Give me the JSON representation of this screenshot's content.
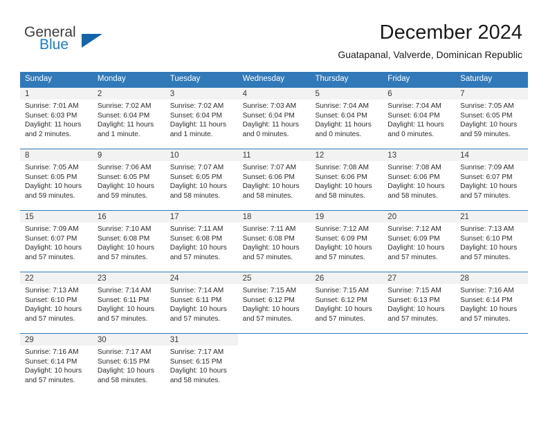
{
  "brand": {
    "name_part1": "General",
    "name_part2": "Blue",
    "triangle_color": "#1464aa",
    "blue_color": "#1d7cc4"
  },
  "header": {
    "title": "December 2024",
    "subtitle": "Guatapanal, Valverde, Dominican Republic"
  },
  "theme": {
    "header_blue": "#3179b8",
    "day_band_gray": "#f2f2f2"
  },
  "weekdays": [
    "Sunday",
    "Monday",
    "Tuesday",
    "Wednesday",
    "Thursday",
    "Friday",
    "Saturday"
  ],
  "weeks": [
    [
      {
        "day": "1",
        "sunrise": "Sunrise: 7:01 AM",
        "sunset": "Sunset: 6:03 PM",
        "daylight1": "Daylight: 11 hours",
        "daylight2": "and 2 minutes."
      },
      {
        "day": "2",
        "sunrise": "Sunrise: 7:02 AM",
        "sunset": "Sunset: 6:04 PM",
        "daylight1": "Daylight: 11 hours",
        "daylight2": "and 1 minute."
      },
      {
        "day": "3",
        "sunrise": "Sunrise: 7:02 AM",
        "sunset": "Sunset: 6:04 PM",
        "daylight1": "Daylight: 11 hours",
        "daylight2": "and 1 minute."
      },
      {
        "day": "4",
        "sunrise": "Sunrise: 7:03 AM",
        "sunset": "Sunset: 6:04 PM",
        "daylight1": "Daylight: 11 hours",
        "daylight2": "and 0 minutes."
      },
      {
        "day": "5",
        "sunrise": "Sunrise: 7:04 AM",
        "sunset": "Sunset: 6:04 PM",
        "daylight1": "Daylight: 11 hours",
        "daylight2": "and 0 minutes."
      },
      {
        "day": "6",
        "sunrise": "Sunrise: 7:04 AM",
        "sunset": "Sunset: 6:04 PM",
        "daylight1": "Daylight: 11 hours",
        "daylight2": "and 0 minutes."
      },
      {
        "day": "7",
        "sunrise": "Sunrise: 7:05 AM",
        "sunset": "Sunset: 6:05 PM",
        "daylight1": "Daylight: 10 hours",
        "daylight2": "and 59 minutes."
      }
    ],
    [
      {
        "day": "8",
        "sunrise": "Sunrise: 7:05 AM",
        "sunset": "Sunset: 6:05 PM",
        "daylight1": "Daylight: 10 hours",
        "daylight2": "and 59 minutes."
      },
      {
        "day": "9",
        "sunrise": "Sunrise: 7:06 AM",
        "sunset": "Sunset: 6:05 PM",
        "daylight1": "Daylight: 10 hours",
        "daylight2": "and 59 minutes."
      },
      {
        "day": "10",
        "sunrise": "Sunrise: 7:07 AM",
        "sunset": "Sunset: 6:05 PM",
        "daylight1": "Daylight: 10 hours",
        "daylight2": "and 58 minutes."
      },
      {
        "day": "11",
        "sunrise": "Sunrise: 7:07 AM",
        "sunset": "Sunset: 6:06 PM",
        "daylight1": "Daylight: 10 hours",
        "daylight2": "and 58 minutes."
      },
      {
        "day": "12",
        "sunrise": "Sunrise: 7:08 AM",
        "sunset": "Sunset: 6:06 PM",
        "daylight1": "Daylight: 10 hours",
        "daylight2": "and 58 minutes."
      },
      {
        "day": "13",
        "sunrise": "Sunrise: 7:08 AM",
        "sunset": "Sunset: 6:06 PM",
        "daylight1": "Daylight: 10 hours",
        "daylight2": "and 58 minutes."
      },
      {
        "day": "14",
        "sunrise": "Sunrise: 7:09 AM",
        "sunset": "Sunset: 6:07 PM",
        "daylight1": "Daylight: 10 hours",
        "daylight2": "and 57 minutes."
      }
    ],
    [
      {
        "day": "15",
        "sunrise": "Sunrise: 7:09 AM",
        "sunset": "Sunset: 6:07 PM",
        "daylight1": "Daylight: 10 hours",
        "daylight2": "and 57 minutes."
      },
      {
        "day": "16",
        "sunrise": "Sunrise: 7:10 AM",
        "sunset": "Sunset: 6:08 PM",
        "daylight1": "Daylight: 10 hours",
        "daylight2": "and 57 minutes."
      },
      {
        "day": "17",
        "sunrise": "Sunrise: 7:11 AM",
        "sunset": "Sunset: 6:08 PM",
        "daylight1": "Daylight: 10 hours",
        "daylight2": "and 57 minutes."
      },
      {
        "day": "18",
        "sunrise": "Sunrise: 7:11 AM",
        "sunset": "Sunset: 6:08 PM",
        "daylight1": "Daylight: 10 hours",
        "daylight2": "and 57 minutes."
      },
      {
        "day": "19",
        "sunrise": "Sunrise: 7:12 AM",
        "sunset": "Sunset: 6:09 PM",
        "daylight1": "Daylight: 10 hours",
        "daylight2": "and 57 minutes."
      },
      {
        "day": "20",
        "sunrise": "Sunrise: 7:12 AM",
        "sunset": "Sunset: 6:09 PM",
        "daylight1": "Daylight: 10 hours",
        "daylight2": "and 57 minutes."
      },
      {
        "day": "21",
        "sunrise": "Sunrise: 7:13 AM",
        "sunset": "Sunset: 6:10 PM",
        "daylight1": "Daylight: 10 hours",
        "daylight2": "and 57 minutes."
      }
    ],
    [
      {
        "day": "22",
        "sunrise": "Sunrise: 7:13 AM",
        "sunset": "Sunset: 6:10 PM",
        "daylight1": "Daylight: 10 hours",
        "daylight2": "and 57 minutes."
      },
      {
        "day": "23",
        "sunrise": "Sunrise: 7:14 AM",
        "sunset": "Sunset: 6:11 PM",
        "daylight1": "Daylight: 10 hours",
        "daylight2": "and 57 minutes."
      },
      {
        "day": "24",
        "sunrise": "Sunrise: 7:14 AM",
        "sunset": "Sunset: 6:11 PM",
        "daylight1": "Daylight: 10 hours",
        "daylight2": "and 57 minutes."
      },
      {
        "day": "25",
        "sunrise": "Sunrise: 7:15 AM",
        "sunset": "Sunset: 6:12 PM",
        "daylight1": "Daylight: 10 hours",
        "daylight2": "and 57 minutes."
      },
      {
        "day": "26",
        "sunrise": "Sunrise: 7:15 AM",
        "sunset": "Sunset: 6:12 PM",
        "daylight1": "Daylight: 10 hours",
        "daylight2": "and 57 minutes."
      },
      {
        "day": "27",
        "sunrise": "Sunrise: 7:15 AM",
        "sunset": "Sunset: 6:13 PM",
        "daylight1": "Daylight: 10 hours",
        "daylight2": "and 57 minutes."
      },
      {
        "day": "28",
        "sunrise": "Sunrise: 7:16 AM",
        "sunset": "Sunset: 6:14 PM",
        "daylight1": "Daylight: 10 hours",
        "daylight2": "and 57 minutes."
      }
    ],
    [
      {
        "day": "29",
        "sunrise": "Sunrise: 7:16 AM",
        "sunset": "Sunset: 6:14 PM",
        "daylight1": "Daylight: 10 hours",
        "daylight2": "and 57 minutes."
      },
      {
        "day": "30",
        "sunrise": "Sunrise: 7:17 AM",
        "sunset": "Sunset: 6:15 PM",
        "daylight1": "Daylight: 10 hours",
        "daylight2": "and 58 minutes."
      },
      {
        "day": "31",
        "sunrise": "Sunrise: 7:17 AM",
        "sunset": "Sunset: 6:15 PM",
        "daylight1": "Daylight: 10 hours",
        "daylight2": "and 58 minutes."
      },
      {
        "day": "",
        "sunrise": "",
        "sunset": "",
        "daylight1": "",
        "daylight2": ""
      },
      {
        "day": "",
        "sunrise": "",
        "sunset": "",
        "daylight1": "",
        "daylight2": ""
      },
      {
        "day": "",
        "sunrise": "",
        "sunset": "",
        "daylight1": "",
        "daylight2": ""
      },
      {
        "day": "",
        "sunrise": "",
        "sunset": "",
        "daylight1": "",
        "daylight2": ""
      }
    ]
  ]
}
